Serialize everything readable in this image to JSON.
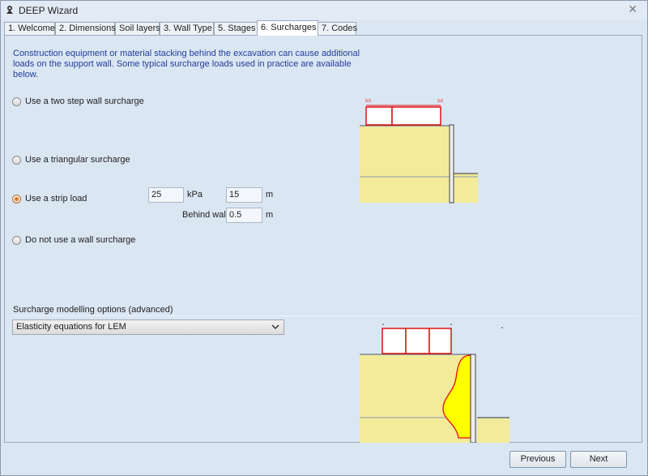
{
  "window": {
    "title": "DEEP Wizard",
    "close_glyph": "✕",
    "icon": "deep-app-icon"
  },
  "tabs": [
    {
      "label": "1. Welcome"
    },
    {
      "label": "2. Dimensions"
    },
    {
      "label": "Soil layers"
    },
    {
      "label": "3. Wall Type"
    },
    {
      "label": "5. Stages"
    },
    {
      "label": "6. Surcharges",
      "active": true
    },
    {
      "label": "7. Codes"
    }
  ],
  "intro_text": "Construction equipment or material stacking behind the excavation can cause additional loads on the support wall. Some typical surcharge loads used in practice are available below.",
  "options": [
    {
      "label": "Use a two step wall surcharge",
      "selected": false
    },
    {
      "label": "Use a triangular surcharge",
      "selected": false
    },
    {
      "label": "Use a strip load",
      "selected": true
    },
    {
      "label": "Do not use a wall surcharge",
      "selected": false
    }
  ],
  "strip_load": {
    "load_value": "25",
    "load_unit": "kPa",
    "width_value": "15",
    "width_unit": "m",
    "behind_wall_label": "Behind wall",
    "behind_wall_value": "0.5",
    "behind_wall_unit": "m"
  },
  "diagram_top": {
    "left_label": "0.5",
    "right_label": "3.6"
  },
  "modelling": {
    "label": "Surcharge modelling options (advanced)",
    "selected": "Elasticity equations for LEM"
  },
  "buttons": {
    "previous": "Previous",
    "next": "Next"
  },
  "colors": {
    "accent_text": "#1f3d9b",
    "soil": "#f2eb9a",
    "load_outline": "#e01010",
    "pressure": "#ffff00"
  }
}
